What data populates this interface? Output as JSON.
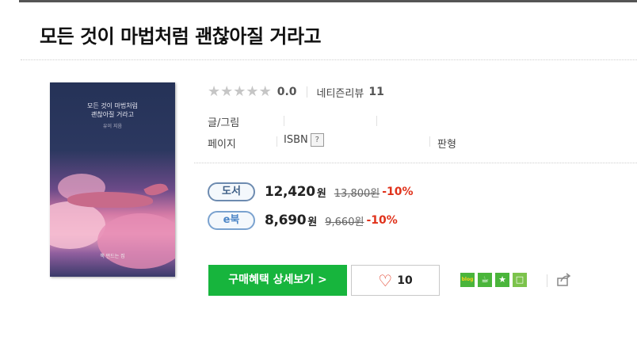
{
  "book": {
    "title": "모든 것이 마법처럼 괜찮아질 거라고",
    "cover": {
      "title_line1": "모든 것이 마법처럼",
      "title_line2": "괜찮아질 거라고",
      "author": "유이 지음",
      "publisher": "책 만드는 집"
    }
  },
  "rating": {
    "stars": "★",
    "score": "0.0",
    "review_label": "네티즌리뷰",
    "review_count": "11"
  },
  "info": {
    "author_label": "글/그림",
    "pages_label": "페이지",
    "isbn_label": "ISBN",
    "isbn_help": "?",
    "format_label": "판형"
  },
  "prices": {
    "book": {
      "badge": "도서",
      "sale": "12,420",
      "won": "원",
      "original": "13,800원",
      "discount": "-10%"
    },
    "ebook": {
      "badge": "e북",
      "sale": "8,690",
      "won": "원",
      "original": "9,660원",
      "discount": "-10%"
    }
  },
  "actions": {
    "buy_label": "구매혜택 상세보기 >",
    "like_count": "10",
    "heart": "♡"
  },
  "share": {
    "blog": "blog",
    "cafe": "☕",
    "star": "★",
    "memo": "□",
    "share_icon": "share-icon"
  },
  "colors": {
    "buy_green": "#17b53d",
    "discount_red": "#e0321b",
    "badge_blue": "#3e5f86"
  }
}
